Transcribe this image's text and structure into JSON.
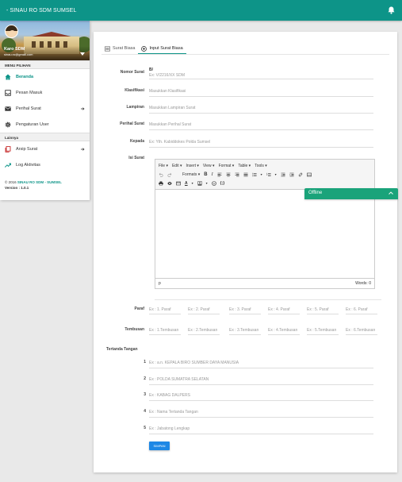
{
  "app": {
    "title": "- SINAU RO SDM SUMSEL"
  },
  "user": {
    "name": "Karo SDM",
    "email": "sinau.ro@gmail.com"
  },
  "sidebar": {
    "section_main": "MENU PILIHAN",
    "items": [
      {
        "label": "Beranda",
        "icon": "home-icon"
      },
      {
        "label": "Pesan Masuk",
        "icon": "inbox-icon"
      },
      {
        "label": "Perihal Surat",
        "icon": "mail-icon"
      },
      {
        "label": "Pengaturan User",
        "icon": "gear-icon"
      }
    ],
    "section_other": "Lainnya",
    "other_items": [
      {
        "label": "Arsip Surat",
        "icon": "archive-icon"
      },
      {
        "label": "Log Aktivitas",
        "icon": "trending-icon"
      }
    ],
    "copyright_prefix": "© 2016",
    "copyright_brand": "SINAU RO SDM - SUMSEL",
    "version": "Version : 1.0.1"
  },
  "tabs": [
    {
      "label": "Surat Biasa",
      "icon": "list-icon"
    },
    {
      "label": "Input Surat Biasa",
      "icon": "add-circle-icon"
    }
  ],
  "form": {
    "nomor": {
      "label": "Nomor Surat",
      "prefix": "B/",
      "placeholder": "Ex: V/2216/XX SDM"
    },
    "klasifikasi": {
      "label": "Klasifikasi",
      "placeholder": "Masukkan Klasifikasi"
    },
    "lampiran": {
      "label": "Lampiran",
      "placeholder": "Masukkan Lampiran Surat"
    },
    "perihal": {
      "label": "Perihal Surat",
      "placeholder": "Masukkan Perihal Surat"
    },
    "kepada": {
      "label": "Kepada",
      "placeholder": "Ex: Yth. Kabiddokes Polda Sumsel"
    },
    "isi": {
      "label": "Isi Surat"
    },
    "paraf": {
      "label": "Paraf",
      "fields": [
        "Ex : 1. Paraf",
        "Ex : 2. Paraf",
        "Ex : 3. Paraf",
        "Ex : 4. Paraf",
        "Ex : 5. Paraf",
        "Ex : 6. Paraf"
      ]
    },
    "tembusan": {
      "label": "Tembusan",
      "fields": [
        "Ex : 1.Tembusan",
        "Ex : 2.Tembusan",
        "Ex : 3.Tembusan",
        "Ex : 4.Tembusan",
        "Ex : 5.Tembusan",
        "Ex : 6.Tembusan"
      ]
    },
    "tertanda": {
      "label": "Tertanda Tangan",
      "rows": [
        {
          "num": "1",
          "placeholder": "Ex : a.n. KEPALA BIRO SUMBER DAYA MANUSIA"
        },
        {
          "num": "2",
          "placeholder": "Ex : POLDA SUMATRA SELATAN"
        },
        {
          "num": "3",
          "placeholder": "Ex : KABAG DALPERS"
        },
        {
          "num": "4",
          "placeholder": "Ex : Nama Tertanda Tangan"
        },
        {
          "num": "5",
          "placeholder": "Ex : Jabatong Lengkap"
        }
      ]
    },
    "submit": "SIMPAN"
  },
  "editor": {
    "menu": [
      "File",
      "Edit",
      "Insert",
      "View",
      "Format",
      "Table",
      "Tools"
    ],
    "formats": "Formats",
    "path": "p",
    "words": "Words: 0"
  },
  "chat": {
    "label": "Offline"
  }
}
